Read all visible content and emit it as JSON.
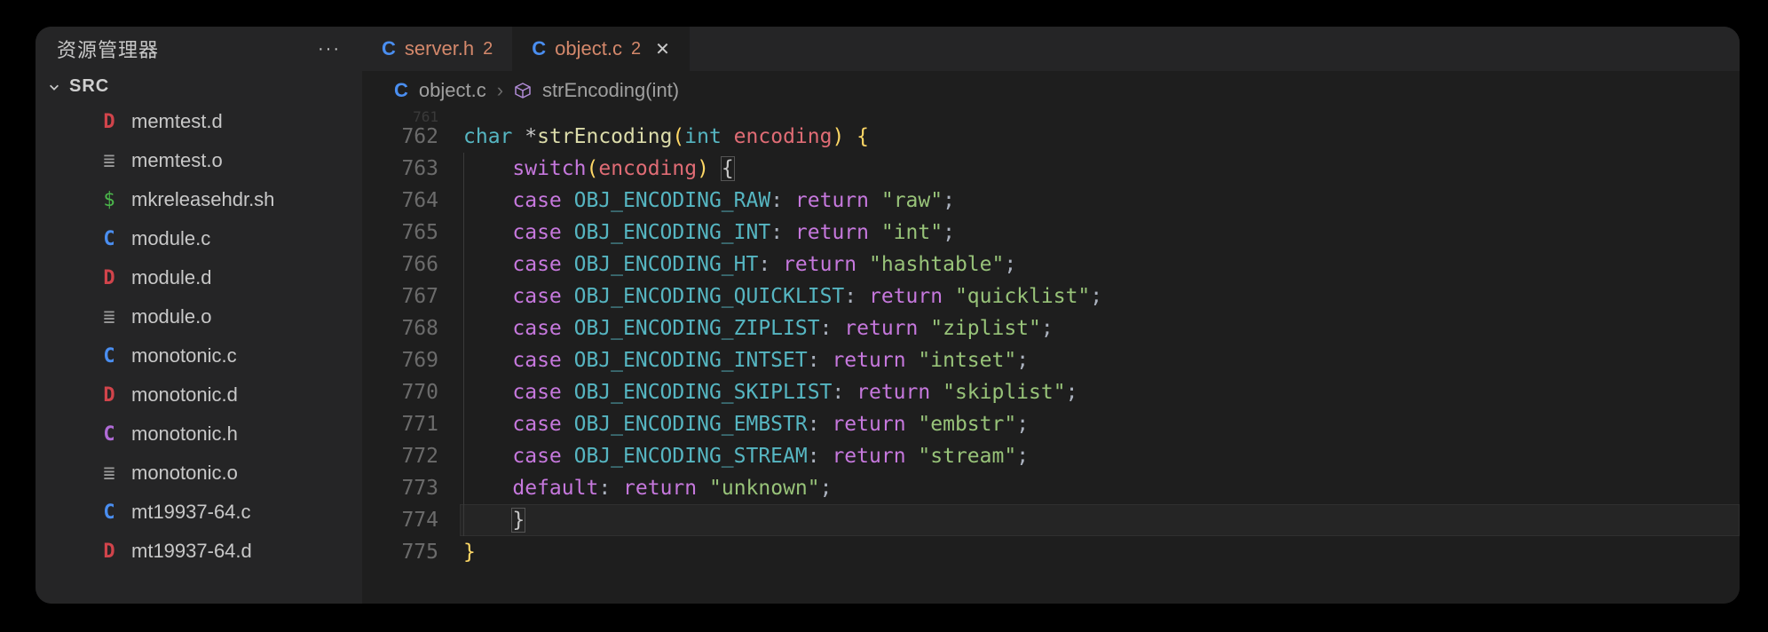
{
  "sidebar": {
    "title": "资源管理器",
    "section": "SRC",
    "files": [
      {
        "icon": "D",
        "iconClass": "ic-D",
        "name": "memtest.d"
      },
      {
        "icon": "≣",
        "iconClass": "ic-O",
        "name": "memtest.o"
      },
      {
        "icon": "$",
        "iconClass": "ic-S",
        "name": "mkreleasehdr.sh"
      },
      {
        "icon": "C",
        "iconClass": "ic-C",
        "name": "module.c"
      },
      {
        "icon": "D",
        "iconClass": "ic-D",
        "name": "module.d"
      },
      {
        "icon": "≣",
        "iconClass": "ic-O",
        "name": "module.o"
      },
      {
        "icon": "C",
        "iconClass": "ic-C",
        "name": "monotonic.c"
      },
      {
        "icon": "D",
        "iconClass": "ic-D",
        "name": "monotonic.d"
      },
      {
        "icon": "C",
        "iconClass": "ic-H",
        "name": "monotonic.h"
      },
      {
        "icon": "≣",
        "iconClass": "ic-O",
        "name": "monotonic.o"
      },
      {
        "icon": "C",
        "iconClass": "ic-C",
        "name": "mt19937-64.c"
      },
      {
        "icon": "D",
        "iconClass": "ic-D",
        "name": "mt19937-64.d"
      }
    ]
  },
  "tabs": [
    {
      "icon": "C",
      "name": "server.h",
      "badge": "2",
      "active": false,
      "modified": true,
      "close": false
    },
    {
      "icon": "C",
      "name": "object.c",
      "badge": "2",
      "active": true,
      "modified": true,
      "close": true
    }
  ],
  "breadcrumb": {
    "fileIcon": "C",
    "file": "object.c",
    "symbol": "strEncoding(int)"
  },
  "editor": {
    "dimLine": "761",
    "startLine": 762,
    "cursorLine": 774,
    "lines": [
      [
        {
          "t": "char",
          "c": "tk-type"
        },
        {
          "t": " *",
          "c": "tk-op"
        },
        {
          "t": "strEncoding",
          "c": "tk-fn"
        },
        {
          "t": "(",
          "c": "tk-punc"
        },
        {
          "t": "int",
          "c": "tk-type"
        },
        {
          "t": " encoding",
          "c": "tk-id"
        },
        {
          "t": ")",
          "c": "tk-punc"
        },
        {
          "t": " {",
          "c": "tk-punc"
        }
      ],
      [
        {
          "t": "    ",
          "c": ""
        },
        {
          "t": "switch",
          "c": "tk-kw"
        },
        {
          "t": "(",
          "c": "tk-punc"
        },
        {
          "t": "encoding",
          "c": "tk-id"
        },
        {
          "t": ")",
          "c": "tk-punc"
        },
        {
          "t": " ",
          "c": ""
        },
        {
          "t": "{",
          "c": "tk-brace-hl"
        }
      ],
      [
        {
          "t": "    ",
          "c": ""
        },
        {
          "t": "case",
          "c": "tk-kw"
        },
        {
          "t": " OBJ_ENCODING_RAW",
          "c": "tk-const"
        },
        {
          "t": ":",
          "c": "tk-semi"
        },
        {
          "t": " ",
          "c": ""
        },
        {
          "t": "return",
          "c": "tk-kw"
        },
        {
          "t": " ",
          "c": ""
        },
        {
          "t": "\"raw\"",
          "c": "tk-str"
        },
        {
          "t": ";",
          "c": "tk-semi"
        }
      ],
      [
        {
          "t": "    ",
          "c": ""
        },
        {
          "t": "case",
          "c": "tk-kw"
        },
        {
          "t": " OBJ_ENCODING_INT",
          "c": "tk-const"
        },
        {
          "t": ":",
          "c": "tk-semi"
        },
        {
          "t": " ",
          "c": ""
        },
        {
          "t": "return",
          "c": "tk-kw"
        },
        {
          "t": " ",
          "c": ""
        },
        {
          "t": "\"int\"",
          "c": "tk-str"
        },
        {
          "t": ";",
          "c": "tk-semi"
        }
      ],
      [
        {
          "t": "    ",
          "c": ""
        },
        {
          "t": "case",
          "c": "tk-kw"
        },
        {
          "t": " OBJ_ENCODING_HT",
          "c": "tk-const"
        },
        {
          "t": ":",
          "c": "tk-semi"
        },
        {
          "t": " ",
          "c": ""
        },
        {
          "t": "return",
          "c": "tk-kw"
        },
        {
          "t": " ",
          "c": ""
        },
        {
          "t": "\"hashtable\"",
          "c": "tk-str"
        },
        {
          "t": ";",
          "c": "tk-semi"
        }
      ],
      [
        {
          "t": "    ",
          "c": ""
        },
        {
          "t": "case",
          "c": "tk-kw"
        },
        {
          "t": " OBJ_ENCODING_QUICKLIST",
          "c": "tk-const"
        },
        {
          "t": ":",
          "c": "tk-semi"
        },
        {
          "t": " ",
          "c": ""
        },
        {
          "t": "return",
          "c": "tk-kw"
        },
        {
          "t": " ",
          "c": ""
        },
        {
          "t": "\"quicklist\"",
          "c": "tk-str"
        },
        {
          "t": ";",
          "c": "tk-semi"
        }
      ],
      [
        {
          "t": "    ",
          "c": ""
        },
        {
          "t": "case",
          "c": "tk-kw"
        },
        {
          "t": " OBJ_ENCODING_ZIPLIST",
          "c": "tk-const"
        },
        {
          "t": ":",
          "c": "tk-semi"
        },
        {
          "t": " ",
          "c": ""
        },
        {
          "t": "return",
          "c": "tk-kw"
        },
        {
          "t": " ",
          "c": ""
        },
        {
          "t": "\"ziplist\"",
          "c": "tk-str"
        },
        {
          "t": ";",
          "c": "tk-semi"
        }
      ],
      [
        {
          "t": "    ",
          "c": ""
        },
        {
          "t": "case",
          "c": "tk-kw"
        },
        {
          "t": " OBJ_ENCODING_INTSET",
          "c": "tk-const"
        },
        {
          "t": ":",
          "c": "tk-semi"
        },
        {
          "t": " ",
          "c": ""
        },
        {
          "t": "return",
          "c": "tk-kw"
        },
        {
          "t": " ",
          "c": ""
        },
        {
          "t": "\"intset\"",
          "c": "tk-str"
        },
        {
          "t": ";",
          "c": "tk-semi"
        }
      ],
      [
        {
          "t": "    ",
          "c": ""
        },
        {
          "t": "case",
          "c": "tk-kw"
        },
        {
          "t": " OBJ_ENCODING_SKIPLIST",
          "c": "tk-const"
        },
        {
          "t": ":",
          "c": "tk-semi"
        },
        {
          "t": " ",
          "c": ""
        },
        {
          "t": "return",
          "c": "tk-kw"
        },
        {
          "t": " ",
          "c": ""
        },
        {
          "t": "\"skiplist\"",
          "c": "tk-str"
        },
        {
          "t": ";",
          "c": "tk-semi"
        }
      ],
      [
        {
          "t": "    ",
          "c": ""
        },
        {
          "t": "case",
          "c": "tk-kw"
        },
        {
          "t": " OBJ_ENCODING_EMBSTR",
          "c": "tk-const"
        },
        {
          "t": ":",
          "c": "tk-semi"
        },
        {
          "t": " ",
          "c": ""
        },
        {
          "t": "return",
          "c": "tk-kw"
        },
        {
          "t": " ",
          "c": ""
        },
        {
          "t": "\"embstr\"",
          "c": "tk-str"
        },
        {
          "t": ";",
          "c": "tk-semi"
        }
      ],
      [
        {
          "t": "    ",
          "c": ""
        },
        {
          "t": "case",
          "c": "tk-kw"
        },
        {
          "t": " OBJ_ENCODING_STREAM",
          "c": "tk-const"
        },
        {
          "t": ":",
          "c": "tk-semi"
        },
        {
          "t": " ",
          "c": ""
        },
        {
          "t": "return",
          "c": "tk-kw"
        },
        {
          "t": " ",
          "c": ""
        },
        {
          "t": "\"stream\"",
          "c": "tk-str"
        },
        {
          "t": ";",
          "c": "tk-semi"
        }
      ],
      [
        {
          "t": "    ",
          "c": ""
        },
        {
          "t": "default",
          "c": "tk-kw"
        },
        {
          "t": ":",
          "c": "tk-semi"
        },
        {
          "t": " ",
          "c": ""
        },
        {
          "t": "return",
          "c": "tk-kw"
        },
        {
          "t": " ",
          "c": ""
        },
        {
          "t": "\"unknown\"",
          "c": "tk-str"
        },
        {
          "t": ";",
          "c": "tk-semi"
        }
      ],
      [
        {
          "t": "    ",
          "c": ""
        },
        {
          "t": "}",
          "c": "tk-brace-hl"
        }
      ],
      [
        {
          "t": "}",
          "c": "tk-punc"
        }
      ]
    ]
  }
}
